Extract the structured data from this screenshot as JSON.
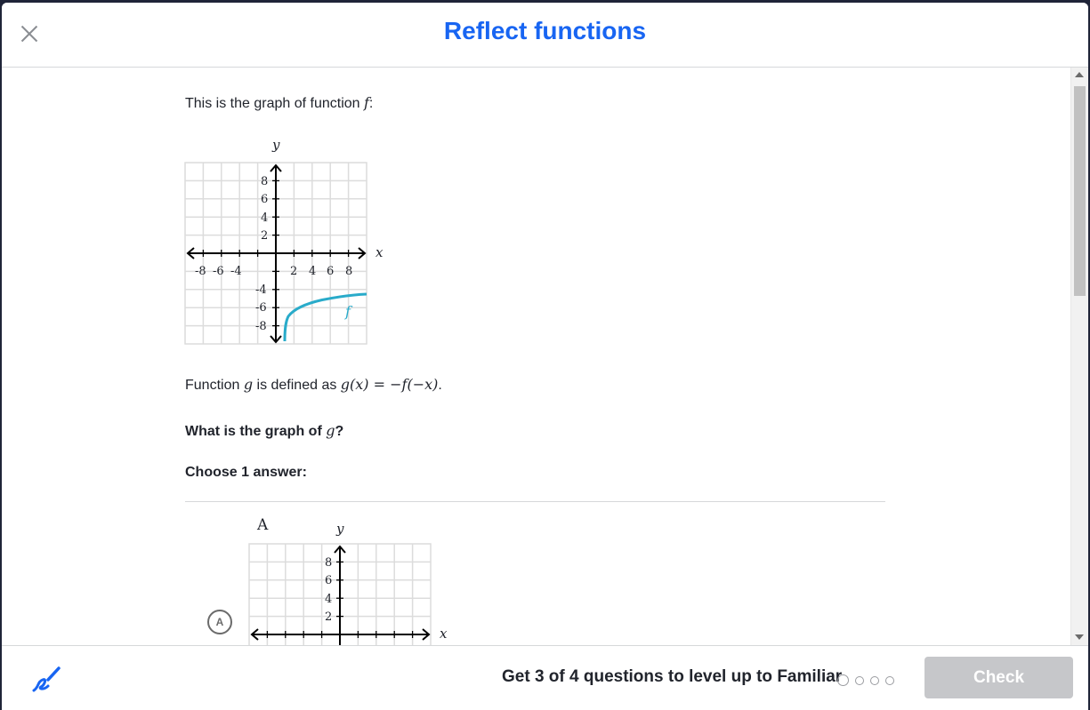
{
  "header": {
    "title": "Reflect functions"
  },
  "question": {
    "intro_text": "This is the graph of function ",
    "intro_var": "f",
    "intro_colon": ":",
    "def_prefix": "Function ",
    "def_var": "g",
    "def_mid": " is defined as ",
    "def_formula": "g(x) = −f(−x)",
    "def_end": ".",
    "ask_prefix": "What is the graph of ",
    "ask_var": "g",
    "ask_q": "?",
    "choose": "Choose 1 answer:"
  },
  "graph_f": {
    "axis_x_label": "x",
    "axis_y_label": "y",
    "x_ticks_neg": [
      "-8",
      "-6",
      "-4"
    ],
    "x_ticks_pos": [
      "2",
      "4",
      "6",
      "8"
    ],
    "y_ticks_pos": [
      "8",
      "6",
      "4",
      "2"
    ],
    "y_ticks_neg": [
      "-4",
      "-6",
      "-8"
    ],
    "curve_label": "f",
    "curve_color": "#29abca"
  },
  "choices": [
    {
      "letter": "A",
      "label": "A",
      "graph": {
        "axis_x_label": "x",
        "axis_y_label": "y",
        "y_ticks_pos": [
          "8",
          "6",
          "4",
          "2"
        ]
      }
    }
  ],
  "footer": {
    "progress_text": "Get 3 of 4 questions to level up to Familiar",
    "check_label": "Check",
    "scratchpad_icon": "scratchpad-pencil-icon"
  },
  "colors": {
    "accent": "#1865f2",
    "curve": "#29abca",
    "disabled_button": "#c6c7ca"
  }
}
